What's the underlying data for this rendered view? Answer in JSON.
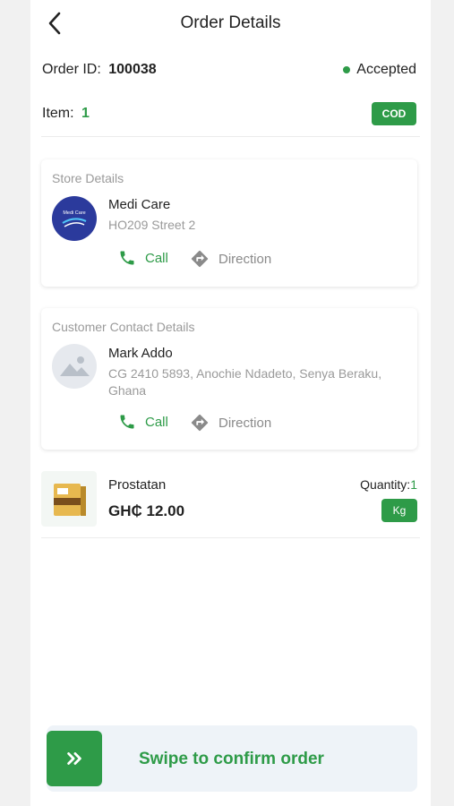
{
  "header": {
    "title": "Order Details",
    "back_icon": "chevron-left-icon"
  },
  "order": {
    "id_label": "Order ID:",
    "id_value": "100038",
    "status": "Accepted",
    "status_color": "#2e9b48",
    "item_label": "Item:",
    "item_count": "1",
    "payment_badge": "COD"
  },
  "store": {
    "section_title": "Store Details",
    "logo_text": "Medi Care",
    "name": "Medi Care",
    "address": "HO209 Street 2",
    "call_label": "Call",
    "direction_label": "Direction"
  },
  "customer": {
    "section_title": "Customer Contact Details",
    "name": "Mark Addo",
    "address": "CG 2410 5893, Anochie Ndadeto, Senya Beraku, Ghana",
    "call_label": "Call",
    "direction_label": "Direction"
  },
  "product": {
    "name": "Prostatan",
    "price": "GH₵ 12.00",
    "quantity_label": "Quantity:",
    "quantity_value": "1",
    "unit": "Kg"
  },
  "swipe": {
    "label": "Swipe to confirm order",
    "icon": "double-chevron-right-icon"
  },
  "colors": {
    "accent": "#2e9b48",
    "muted_text": "#9a9a9a",
    "swipe_bg": "#eef3f8"
  }
}
